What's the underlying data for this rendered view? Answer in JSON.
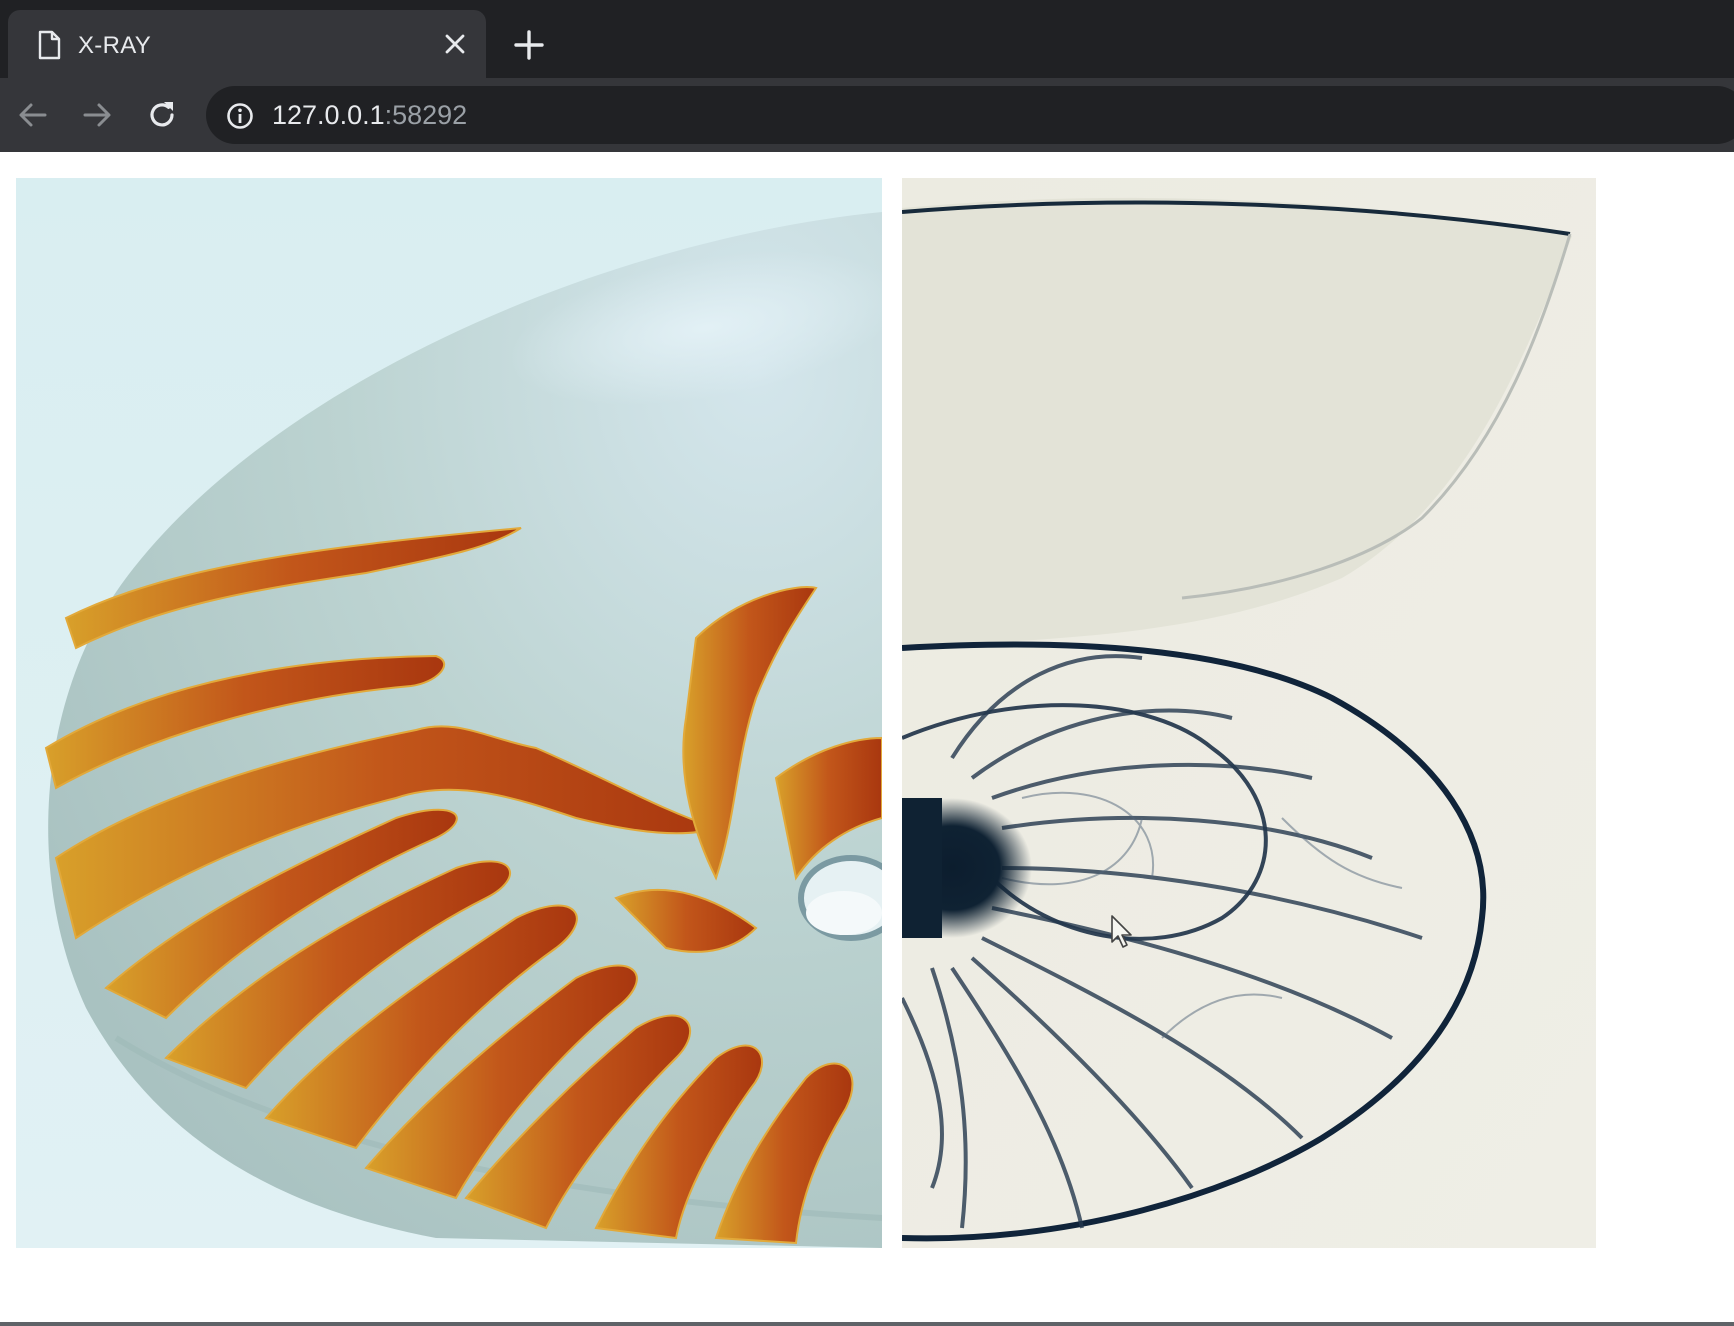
{
  "browser": {
    "tab": {
      "title": "X-RAY"
    },
    "address": {
      "host": "127.0.0.1",
      "port": ":58292"
    }
  },
  "page": {
    "images": [
      {
        "name": "nautilus-shell-photo"
      },
      {
        "name": "nautilus-shell-xray"
      }
    ]
  }
}
